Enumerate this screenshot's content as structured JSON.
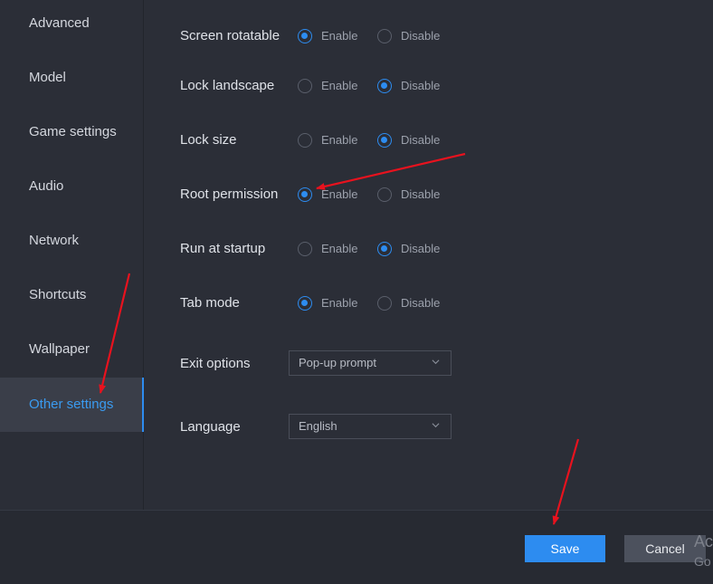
{
  "sidebar": {
    "items": [
      {
        "label": "Advanced"
      },
      {
        "label": "Model"
      },
      {
        "label": "Game settings"
      },
      {
        "label": "Audio"
      },
      {
        "label": "Network"
      },
      {
        "label": "Shortcuts"
      },
      {
        "label": "Wallpaper"
      },
      {
        "label": "Other settings",
        "active": true
      }
    ]
  },
  "settings": {
    "enable_label": "Enable",
    "disable_label": "Disable",
    "rows": [
      {
        "label": "Screen rotatable",
        "selected": "Enable"
      },
      {
        "label": "Lock landscape",
        "selected": "Disable"
      },
      {
        "label": "Lock size",
        "selected": "Disable"
      },
      {
        "label": "Root permission",
        "selected": "Enable"
      },
      {
        "label": "Run at startup",
        "selected": "Disable"
      },
      {
        "label": "Tab mode",
        "selected": "Enable"
      }
    ],
    "exit_options": {
      "label": "Exit options",
      "value": "Pop-up prompt"
    },
    "language": {
      "label": "Language",
      "value": "English"
    }
  },
  "footer": {
    "save_label": "Save",
    "cancel_label": "Cancel",
    "watermark_line1": "Ac",
    "watermark_line2": "Go"
  },
  "colors": {
    "accent": "#2d8cf0",
    "annotation": "#e8121e",
    "background": "#2b2e37"
  },
  "icons": {
    "select_chevron": "chevron-down-icon",
    "annotation": "red-arrow"
  }
}
